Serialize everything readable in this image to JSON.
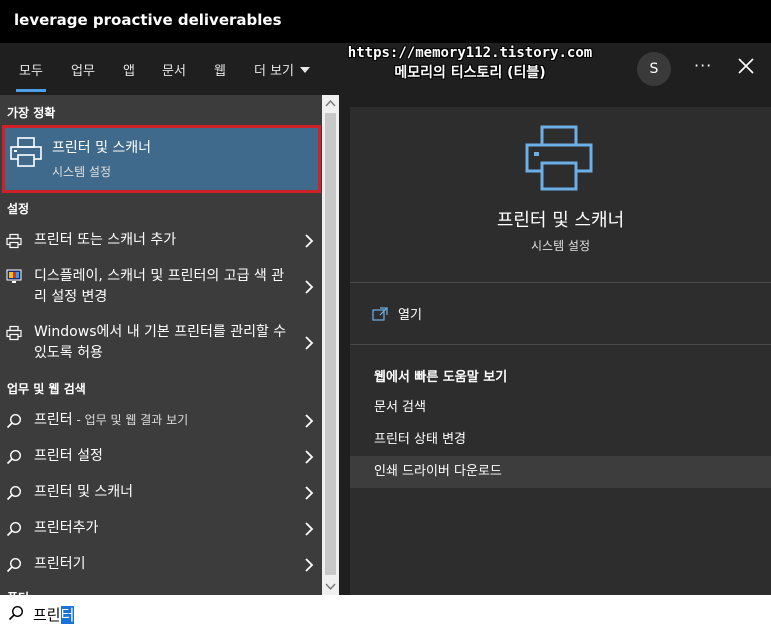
{
  "window": {
    "title": "leverage proactive deliverables"
  },
  "tabs": [
    {
      "label": "모두",
      "active": true
    },
    {
      "label": "업무"
    },
    {
      "label": "앱"
    },
    {
      "label": "문서"
    },
    {
      "label": "웹"
    },
    {
      "label": "더 보기"
    }
  ],
  "watermark": {
    "url": "https://memory112.tistory.com",
    "name": "메모리의 티스토리 (티블)"
  },
  "account": {
    "avatar_letter": "S"
  },
  "header": {
    "more_label": "···"
  },
  "results": {
    "best_match": {
      "heading": "가장 정확",
      "title": "프린터 및 스캐너",
      "subtitle": "시스템 설정"
    },
    "settings_heading": "설정",
    "settings": [
      {
        "text": "프린터 또는 스캐너 추가",
        "icon": "printer-icon"
      },
      {
        "text": "디스플레이, 스캐너 및 프린터의 고급 색 관리 설정 변경",
        "icon": "display-color-icon"
      },
      {
        "text": "Windows에서 내 기본 프린터를 관리할 수 있도록 허용",
        "icon": "printer-icon"
      }
    ],
    "web_heading": "업무 및 웹 검색",
    "web": [
      {
        "query": "프린터",
        "suffix": " - 업무 및 웹 결과 보기"
      },
      {
        "query": "프린터 설정",
        "suffix": ""
      },
      {
        "query": "프린터 및 스캐너",
        "suffix": ""
      },
      {
        "query": "프린터추가",
        "suffix": ""
      },
      {
        "query": "프린터기",
        "suffix": ""
      }
    ],
    "truncated_heading": "폴더"
  },
  "preview": {
    "title": "프린터 및 스캐너",
    "subtitle": "시스템 설정",
    "open_label": "열기",
    "web_help_heading": "웹에서 빠른 도움말 보기",
    "web_help_links": [
      "문서 검색",
      "프린터 상태 변경",
      "인쇄 드라이버 다운로드"
    ]
  },
  "search": {
    "typed": "프린",
    "selected": "터"
  },
  "colors": {
    "accent": "#4f9fe8",
    "selection_bg": "#3f6a8c",
    "highlight_border": "#d0202a",
    "text_selection": "#1a72d8"
  }
}
